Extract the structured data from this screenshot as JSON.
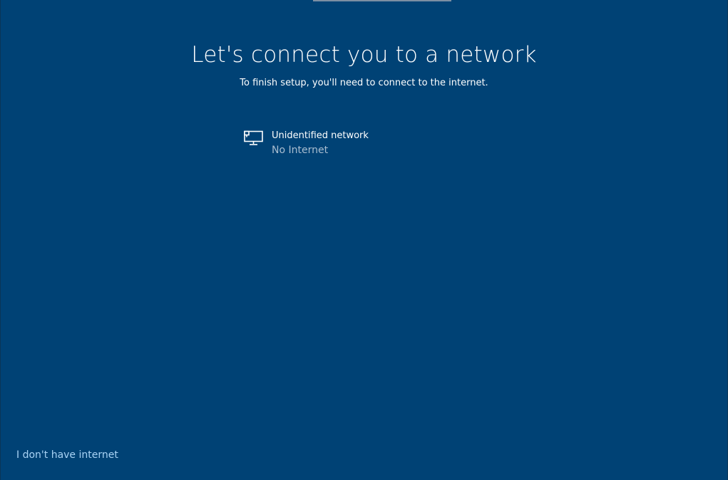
{
  "page": {
    "title": "Let's connect you to a network",
    "subtitle": "To finish setup, you'll need to connect to the internet."
  },
  "networks": [
    {
      "name": "Unidentified network",
      "status": "No Internet",
      "icon": "wired-ethernet-icon"
    }
  ],
  "footer": {
    "no_internet_label": "I don't have internet"
  },
  "colors": {
    "background": "#004275",
    "text": "#ffffff",
    "secondary_text": "#a9bdd0",
    "link": "#a9d3f5"
  }
}
